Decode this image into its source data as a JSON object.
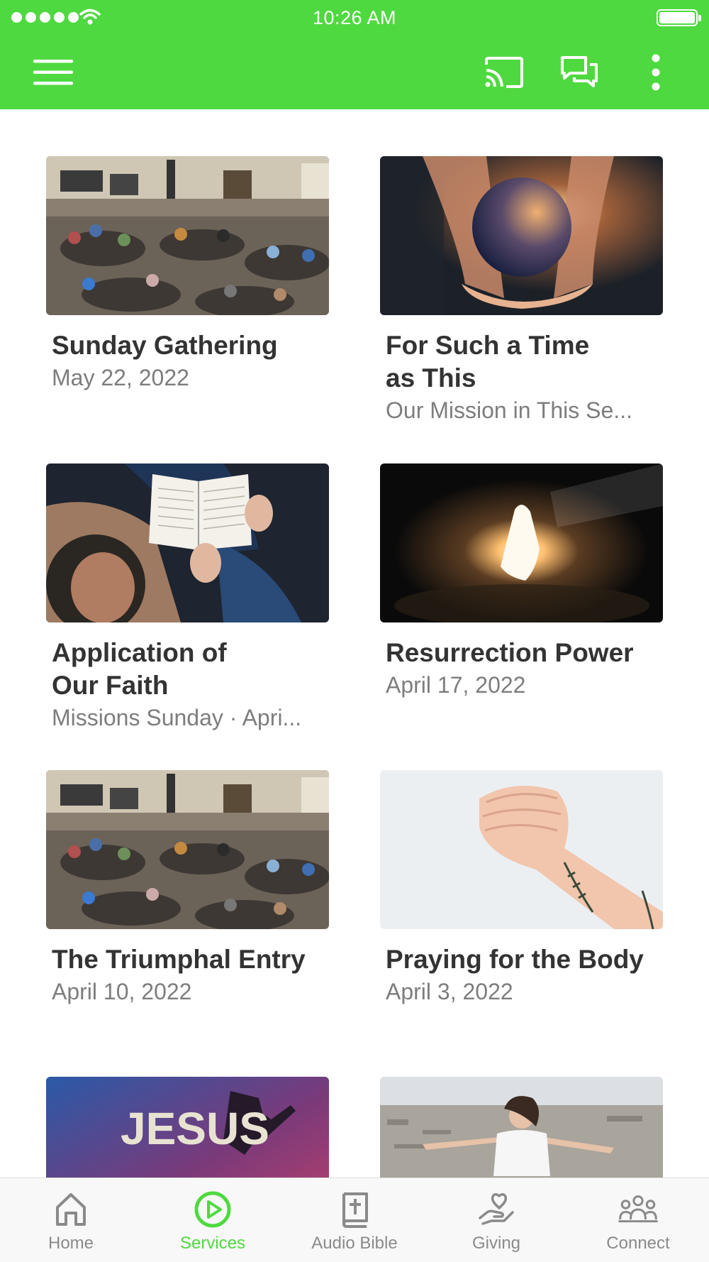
{
  "status_bar": {
    "time": "10:26 AM"
  },
  "app_bar": {
    "icons": [
      "menu-icon",
      "cast-icon",
      "chat-icon",
      "more-vertical-icon"
    ],
    "accent_color": "#4fd940"
  },
  "sermons": [
    {
      "title": "Sunday Gathering",
      "subtitle": "May 22, 2022",
      "image": "church-gathering-photo"
    },
    {
      "title": "For Such a Time as This",
      "subtitle": "Our Mission in This Se...",
      "image": "hands-holding-earth-photo"
    },
    {
      "title": "Application of Our Faith",
      "subtitle": "Missions Sunday · Apri...",
      "image": "open-bible-reading-photo"
    },
    {
      "title": "Resurrection Power",
      "subtitle": "April 17, 2022",
      "image": "empty-tomb-light-photo"
    },
    {
      "title": "The Triumphal Entry",
      "subtitle": "April 10, 2022",
      "image": "church-gathering-photo"
    },
    {
      "title": "Praying for the Body",
      "subtitle": "April 3, 2022",
      "image": "praying-hands-photo"
    },
    {
      "title": "",
      "subtitle": "",
      "image": "jesus-worship-photo",
      "image_text": "JESUS"
    },
    {
      "title": "",
      "subtitle": "",
      "image": "woman-arms-outstretched-photo"
    }
  ],
  "tabs": [
    {
      "label": "Home",
      "icon": "home-icon",
      "active": false
    },
    {
      "label": "Services",
      "icon": "play-circle-icon",
      "active": true
    },
    {
      "label": "Audio Bible",
      "icon": "bible-icon",
      "active": false
    },
    {
      "label": "Giving",
      "icon": "giving-hand-heart-icon",
      "active": false
    },
    {
      "label": "Connect",
      "icon": "people-icon",
      "active": false
    }
  ]
}
